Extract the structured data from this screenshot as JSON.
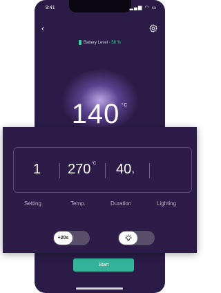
{
  "status_bar": {
    "time": "9:41",
    "icons": "signal-wifi-battery"
  },
  "header": {
    "back_icon": "chevron-left-icon",
    "settings_icon": "gear-icon"
  },
  "battery": {
    "label": "Battery Level · ",
    "percent": "58 %"
  },
  "main": {
    "temperature": "140",
    "unit": "°C"
  },
  "params": {
    "setting": {
      "value": "1",
      "label": "Setting"
    },
    "temp": {
      "value": "270",
      "unit": "°C",
      "label": "Temp."
    },
    "duration": {
      "value": "40",
      "unit": "s",
      "label": "Duration"
    },
    "lighting": {
      "label": "Lighting",
      "icon": "lighting-wave-icon"
    }
  },
  "toggles": {
    "boost": {
      "label": "+20s",
      "on": false
    },
    "light": {
      "icon": "lightbulb-icon",
      "on": false
    }
  },
  "start": {
    "label": "Start"
  },
  "colors": {
    "accent": "#35b39a",
    "battery": "#37d29e",
    "background": "#2a1c46"
  }
}
